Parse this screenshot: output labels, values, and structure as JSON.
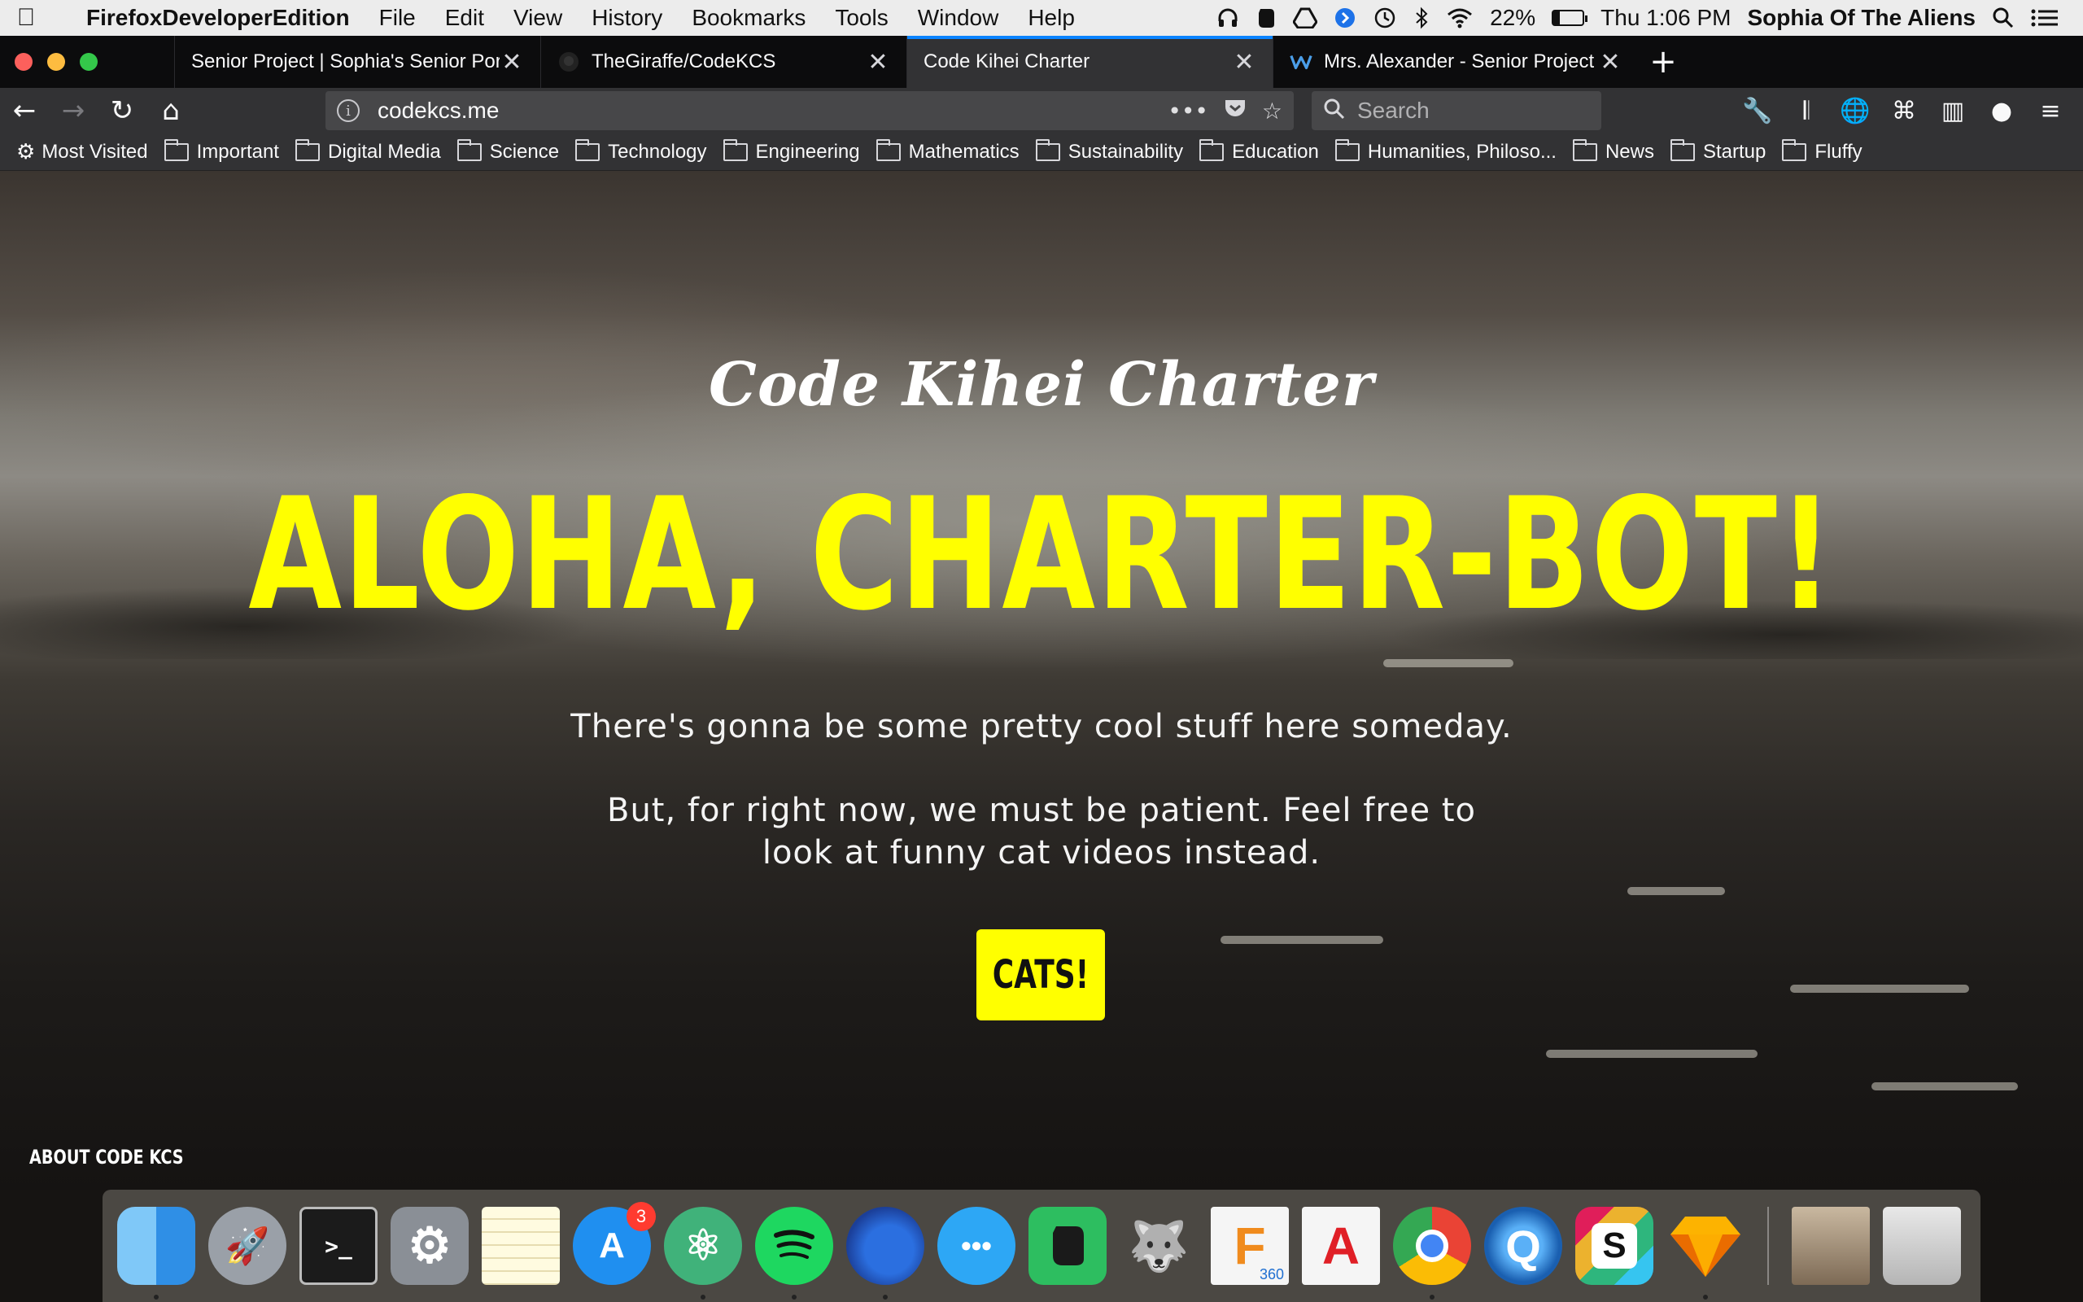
{
  "menubar": {
    "app_name": "FirefoxDeveloperEdition",
    "menus": [
      "File",
      "Edit",
      "View",
      "History",
      "Bookmarks",
      "Tools",
      "Window",
      "Help"
    ],
    "battery": "22%",
    "battery_level": 0.22,
    "clock": "Thu 1:06 PM",
    "user": "Sophia Of The Aliens"
  },
  "tabs": [
    {
      "title": "Senior Project | Sophia's Senior Portfolio",
      "active": false
    },
    {
      "title": "TheGiraffe/CodeKCS",
      "active": false
    },
    {
      "title": "Code Kihei Charter",
      "active": true
    },
    {
      "title": "Mrs. Alexander - Senior Project",
      "active": false
    }
  ],
  "navbar": {
    "url": "codekcs.me",
    "search_placeholder": "Search"
  },
  "bookmarks": [
    "Most Visited",
    "Important",
    "Digital Media",
    "Science",
    "Technology",
    "Engineering",
    "Mathematics",
    "Sustainability",
    "Education",
    "Humanities, Philoso...",
    "News",
    "Startup",
    "Fluffy"
  ],
  "page": {
    "brand": "Code Kihei Charter",
    "headline": "ALOHA, CHARTER-BOT!",
    "tagline": "There's gonna be some pretty cool stuff here someday.",
    "note": "But, for right now, we must be patient. Feel free to look at funny cat videos instead.",
    "cta": "CATS!",
    "footer_link": "ABOUT CODE KCS"
  },
  "dock": {
    "app_store_badge": "3",
    "fusion_label": "360"
  },
  "colors": {
    "accent_yellow": "#ffff00",
    "tab_highlight": "#0a84ff"
  }
}
